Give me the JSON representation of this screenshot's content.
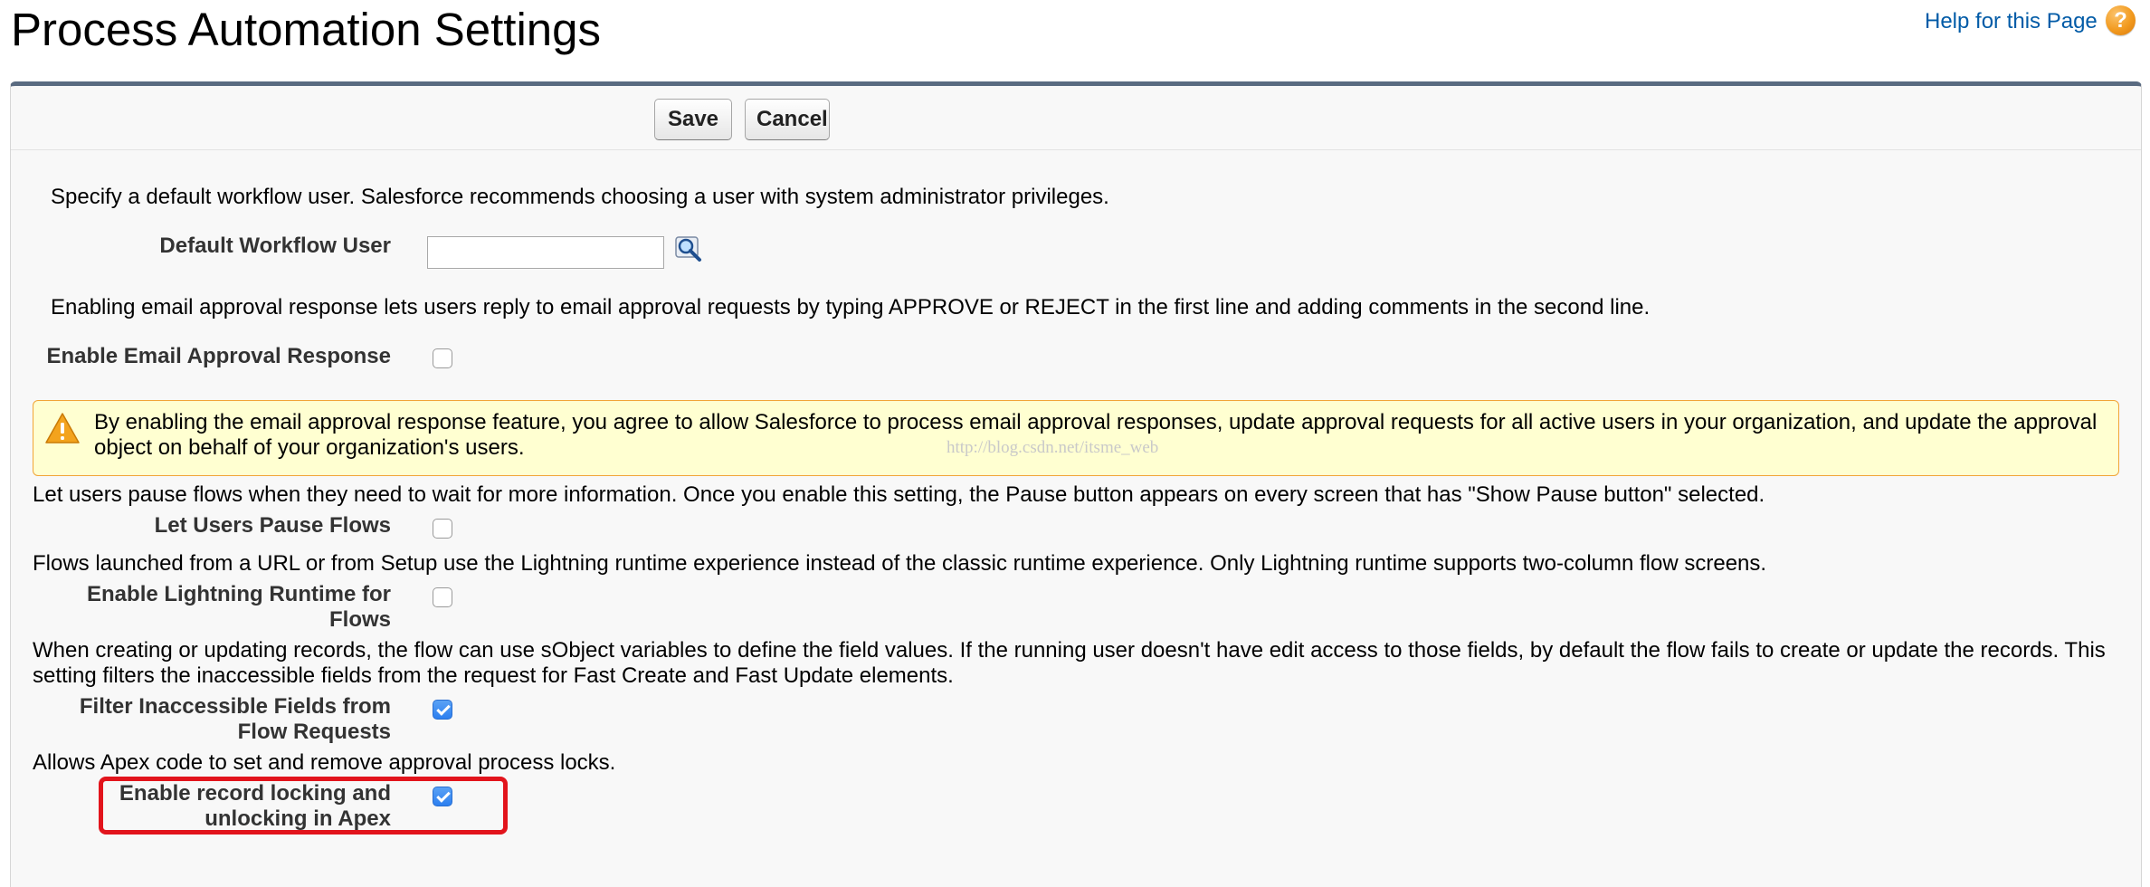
{
  "header": {
    "title": "Process Automation Settings",
    "help_link": "Help for this Page",
    "help_icon": "question-mark-icon"
  },
  "toolbar": {
    "save_label": "Save",
    "cancel_label": "Cancel"
  },
  "workflow_user": {
    "description": "Specify a default workflow user. Salesforce recommends choosing a user with system administrator privileges.",
    "label": "Default Workflow User",
    "value": "",
    "lookup_icon": "lookup-magnifier-icon"
  },
  "email_approval": {
    "description": "Enabling email approval response lets users reply to email approval requests by typing APPROVE or REJECT in the first line and adding comments in the second line.",
    "label": "Enable Email Approval Response",
    "checked": false
  },
  "warning": {
    "icon": "warning-triangle-icon",
    "text": "By enabling the email approval response feature, you agree to allow Salesforce to process email approval responses, update approval requests for all active users in your organization, and update the approval object on behalf of your organization's users.",
    "watermark": "http://blog.csdn.net/itsme_web"
  },
  "pause_flows": {
    "description": "Let users pause flows when they need to wait for more information. Once you enable this setting, the Pause button appears on every screen that has \"Show Pause button\" selected.",
    "label": "Let Users Pause Flows",
    "checked": false
  },
  "lightning_runtime": {
    "description": "Flows launched from a URL or from Setup use the Lightning runtime experience instead of the classic runtime experience. Only Lightning runtime supports two-column flow screens.",
    "label": "Enable Lightning Runtime for Flows",
    "checked": false
  },
  "filter_fields": {
    "description": "When creating or updating records, the flow can use sObject variables to define the field values. If the running user doesn't have edit access to those fields, by default the flow fails to create or update the records. This setting filters the inaccessible fields from the request for Fast Create and Fast Update elements.",
    "label": "Filter Inaccessible Fields from Flow Requests",
    "checked": true
  },
  "record_locking": {
    "description": "Allows Apex code to set and remove approval process locks.",
    "label": "Enable record locking and unlocking in Apex",
    "checked": true
  },
  "colors": {
    "panel_border": "#5a6b81",
    "highlight": "#e2141c",
    "warning_bg": "#ffffd1",
    "warning_border": "#f1a538",
    "link": "#015ba7"
  }
}
